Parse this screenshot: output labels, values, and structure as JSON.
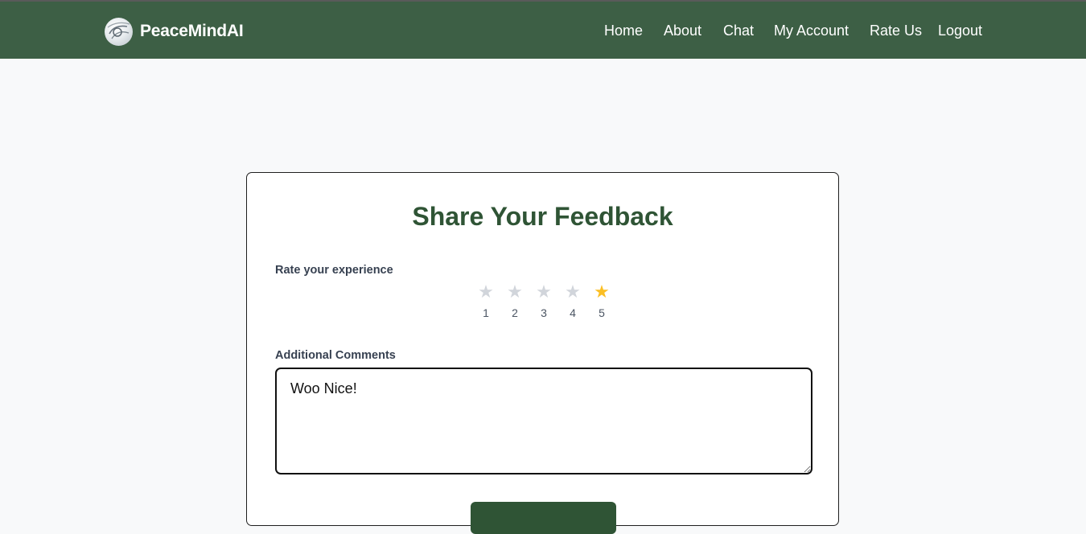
{
  "navbar": {
    "brand": "PeaceMindAI",
    "links": [
      "Home",
      "About",
      "Chat",
      "My Account",
      "Rate Us",
      "Logout"
    ]
  },
  "feedback": {
    "title": "Share Your Feedback",
    "rating_label": "Rate your experience",
    "rating_options": [
      "1",
      "2",
      "3",
      "4",
      "5"
    ],
    "selected_rating": 5,
    "star_glyph": "★",
    "comments_label": "Additional Comments",
    "comments_value": "Woo Nice!"
  },
  "colors": {
    "navbar_bg": "#3d5f45",
    "title": "#2f5435",
    "star_active": "#fbbf24",
    "star_inactive": "#d1d5db"
  }
}
